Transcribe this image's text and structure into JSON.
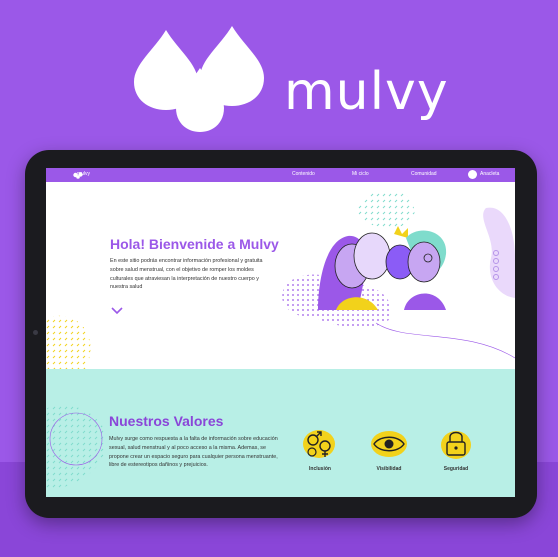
{
  "brand": {
    "name": "mulvy",
    "color": "#9b58e8"
  },
  "nav": {
    "logo_text": "mulvy",
    "items": [
      "Contenido",
      "Mi ciclo",
      "Comunidad"
    ],
    "account_label": "Anacleta"
  },
  "hero": {
    "title": "Hola! Bienvenide a Mulvy",
    "text": "En este sitio podrás encontrar información profesional y gratuita sobre salud menstrual, con el objetivo de romper los moldes culturales que atraviesan la interpretación de nuestro cuerpo y nuestra salud",
    "scroll_icon": "chevron-down-icon"
  },
  "values": {
    "title": "Nuestros Valores",
    "text": "Mulvy surge como respuesta a la falta de información sobre educación sexual, salud menstrual y al poco acceso a la misma. Ademas, se propone crear un espacio seguro para cualquier persona menstruante, libre de estereotipos dañinos y prejuicios.",
    "items": [
      {
        "label": "Inclusión",
        "icon": "gender-symbols-icon"
      },
      {
        "label": "Visibilidad",
        "icon": "eye-icon"
      },
      {
        "label": "Seguridad",
        "icon": "lock-icon"
      }
    ]
  },
  "colors": {
    "purple": "#9b58e8",
    "mint": "#b8efe6",
    "yellow": "#f2d21b",
    "lavender": "#c7a6f2"
  }
}
